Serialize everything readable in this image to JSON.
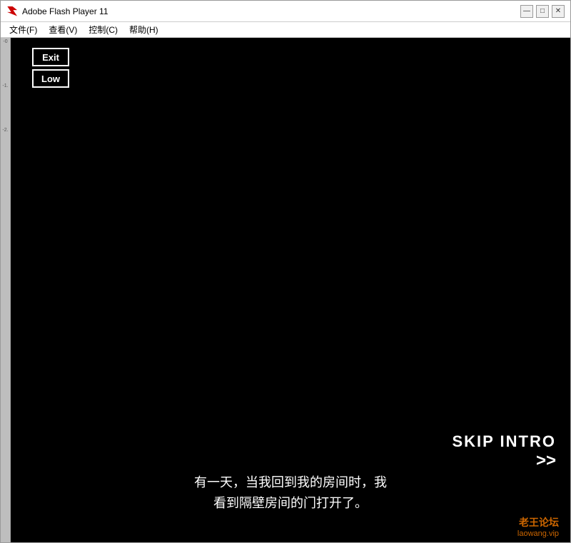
{
  "window": {
    "title": "Adobe Flash Player 11",
    "icon": "flash-icon"
  },
  "titlebar": {
    "title": "Adobe Flash Player 11",
    "minimize_label": "—",
    "restore_label": "□",
    "close_label": "✕"
  },
  "menubar": {
    "items": [
      {
        "label": "文件(F)",
        "id": "menu-file"
      },
      {
        "label": "查看(V)",
        "id": "menu-view"
      },
      {
        "label": "控制(C)",
        "id": "menu-control"
      },
      {
        "label": "帮助(H)",
        "id": "menu-help"
      }
    ]
  },
  "flash": {
    "exit_button": "Exit",
    "low_button": "Low",
    "skip_intro": "SKIP INTRO",
    "skip_arrows": ">>",
    "subtitle_line1": "有一天，当我回到我的房间时，我",
    "subtitle_line2": "看到隔壁房间的门打开了。",
    "watermark_cn": "老王论坛",
    "watermark_en": "laowang.vip"
  },
  "left_markers": [
    "-0",
    "-1.",
    "-2."
  ]
}
